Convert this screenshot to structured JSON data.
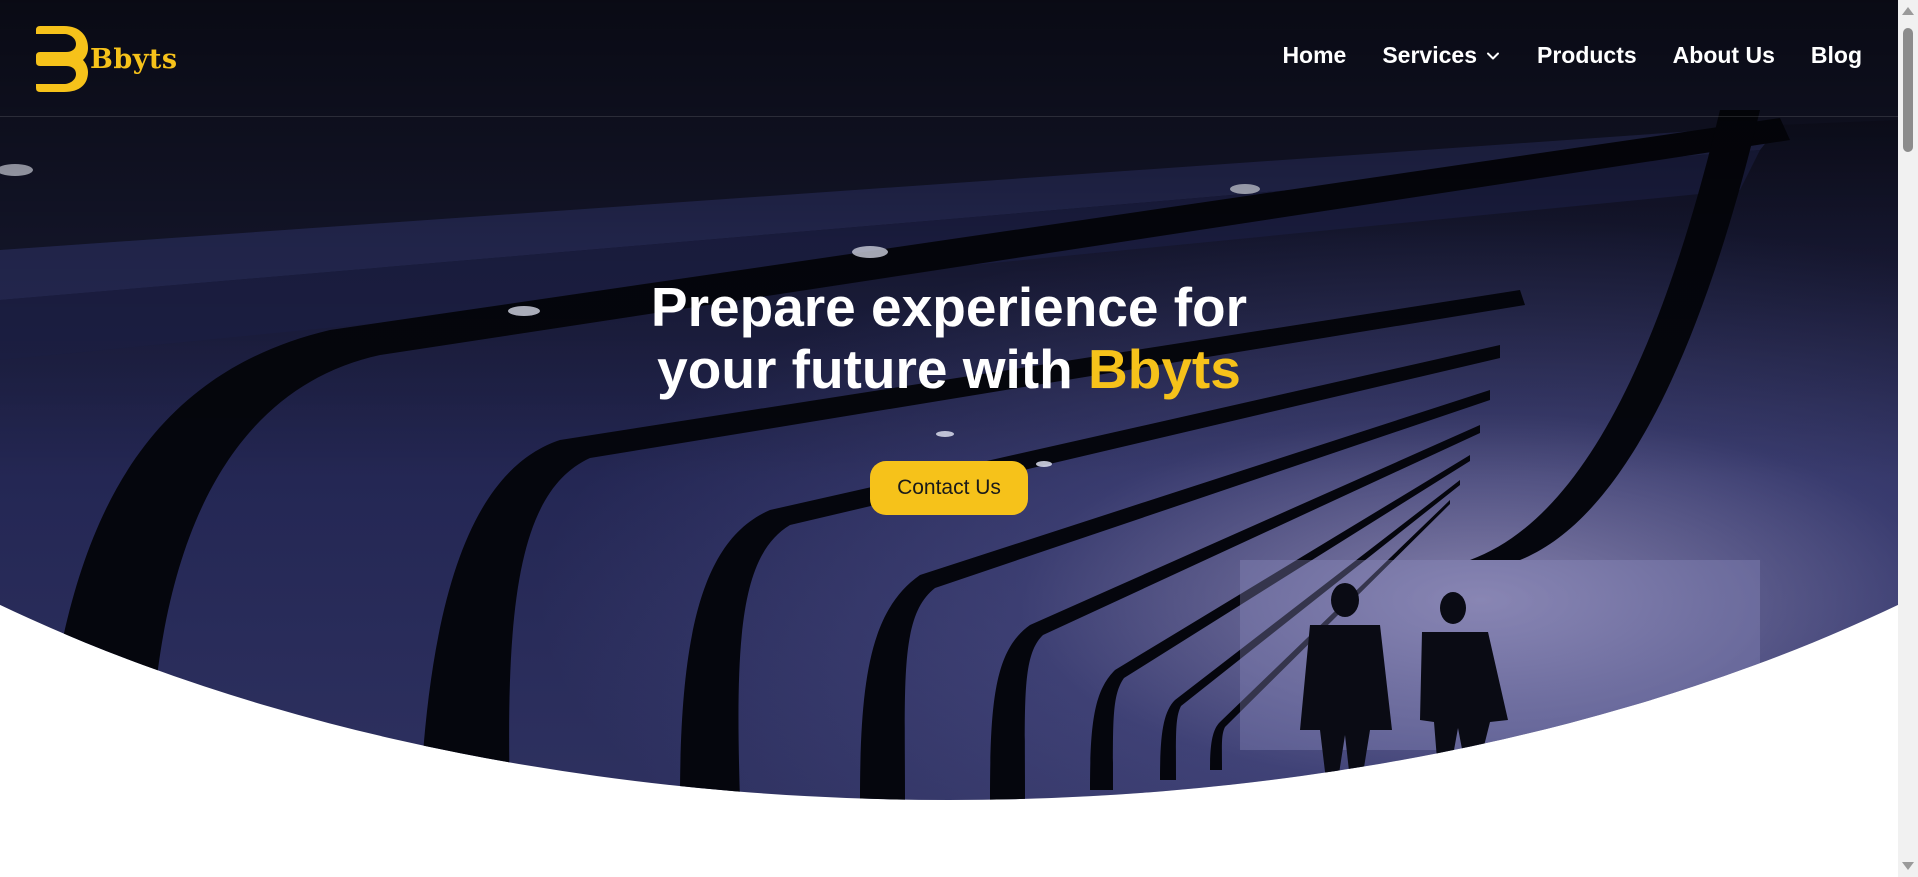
{
  "brand": {
    "name": "Bbyts",
    "color": "#f6c21a",
    "logo_icon": "bbyts-logo-icon"
  },
  "nav": {
    "items": [
      {
        "label": "Home"
      },
      {
        "label": "Services",
        "has_dropdown": true
      },
      {
        "label": "Products"
      },
      {
        "label": "About Us"
      },
      {
        "label": "Blog"
      }
    ]
  },
  "hero": {
    "headline_line1": "Prepare experience for",
    "headline_line2_prefix": "your future with ",
    "headline_line2_accent": "Bbyts",
    "cta_label": "Contact Us",
    "background": "tunnel-photo"
  },
  "colors": {
    "accent": "#f6c21a",
    "text_on_dark": "#ffffff"
  }
}
